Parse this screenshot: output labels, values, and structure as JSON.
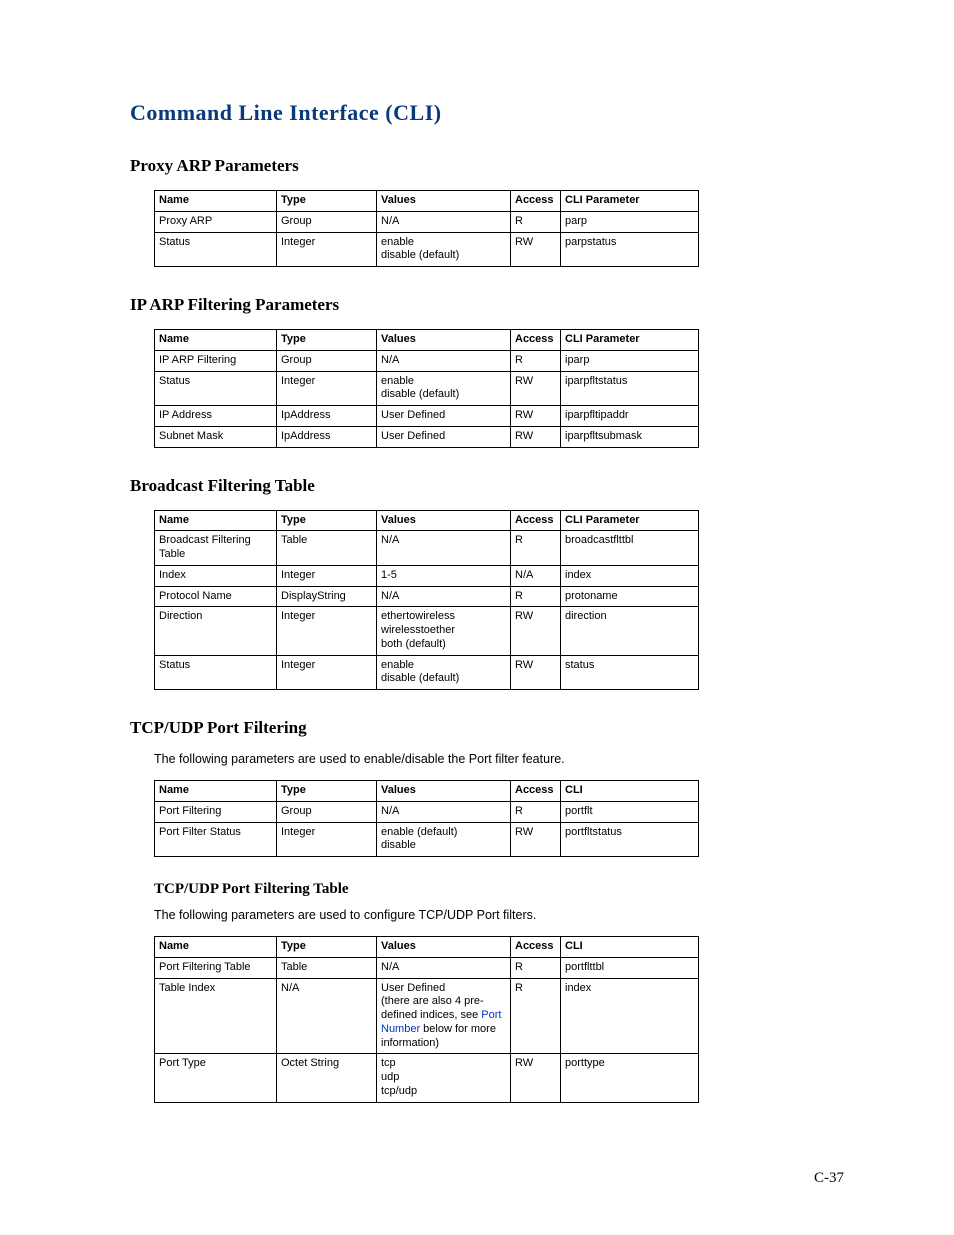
{
  "title": "Command Line Interface (CLI)",
  "page_number": "C-37",
  "port_number_link_text": "Port Number",
  "sections": [
    {
      "heading": "Proxy ARP Parameters",
      "level": "h2",
      "desc": null,
      "cli_header": "CLI Parameter",
      "rows": [
        {
          "name": "Proxy ARP",
          "type": "Group",
          "values": "N/A",
          "access": "R",
          "cli": "parp"
        },
        {
          "name": "Status",
          "type": "Integer",
          "values": "enable\ndisable (default)",
          "access": "RW",
          "cli": "parpstatus"
        }
      ]
    },
    {
      "heading": "IP ARP Filtering Parameters",
      "level": "h2",
      "desc": null,
      "cli_header": "CLI Parameter",
      "rows": [
        {
          "name": "IP ARP Filtering",
          "type": "Group",
          "values": "N/A",
          "access": "R",
          "cli": "iparp"
        },
        {
          "name": "Status",
          "type": "Integer",
          "values": "enable\ndisable (default)",
          "access": "RW",
          "cli": "iparpfltstatus"
        },
        {
          "name": "IP Address",
          "type": "IpAddress",
          "values": "User Defined",
          "access": "RW",
          "cli": "iparpfltipaddr"
        },
        {
          "name": "Subnet Mask",
          "type": "IpAddress",
          "values": "User Defined",
          "access": "RW",
          "cli": "iparpfltsubmask"
        }
      ]
    },
    {
      "heading": "Broadcast Filtering Table",
      "level": "h2",
      "desc": null,
      "cli_header": "CLI Parameter",
      "rows": [
        {
          "name": "Broadcast Filtering Table",
          "type": "Table",
          "values": "N/A",
          "access": "R",
          "cli": "broadcastflttbl"
        },
        {
          "name": "Index",
          "type": "Integer",
          "values": "1-5",
          "access": "N/A",
          "cli": "index"
        },
        {
          "name": "Protocol Name",
          "type": "DisplayString",
          "values": "N/A",
          "access": "R",
          "cli": "protoname"
        },
        {
          "name": "Direction",
          "type": "Integer",
          "values": "ethertowireless\nwirelesstoether\nboth (default)",
          "access": "RW",
          "cli": "direction"
        },
        {
          "name": "Status",
          "type": "Integer",
          "values": "enable\ndisable (default)",
          "access": "RW",
          "cli": "status"
        }
      ]
    },
    {
      "heading": "TCP/UDP Port Filtering",
      "level": "h2",
      "desc": "The following parameters are used to enable/disable the Port filter feature.",
      "cli_header": "CLI",
      "rows": [
        {
          "name": "Port Filtering",
          "type": "Group",
          "values": "N/A",
          "access": "R",
          "cli": "portflt"
        },
        {
          "name": "Port Filter Status",
          "type": "Integer",
          "values": "enable (default)\ndisable",
          "access": "RW",
          "cli": "portfltstatus"
        }
      ]
    },
    {
      "heading": "TCP/UDP Port Filtering Table",
      "level": "h3",
      "desc": "The following parameters are used to configure TCP/UDP Port filters.",
      "cli_header": "CLI",
      "rows": [
        {
          "name": "Port Filtering Table",
          "type": "Table",
          "values": "N/A",
          "access": "R",
          "cli": "portflttbl"
        },
        {
          "name": "Table Index",
          "type": "N/A",
          "values_pre": "User Defined\n(there are also 4 pre-defined indices, see ",
          "values_post": " below for more information)",
          "has_link": true,
          "access": "R",
          "cli": "index"
        },
        {
          "name": "Port Type",
          "type": "Octet String",
          "values": "tcp\nudp\ntcp/udp",
          "access": "RW",
          "cli": "porttype"
        }
      ]
    }
  ],
  "table_headers": {
    "name": "Name",
    "type": "Type",
    "values": "Values",
    "access": "Access"
  }
}
